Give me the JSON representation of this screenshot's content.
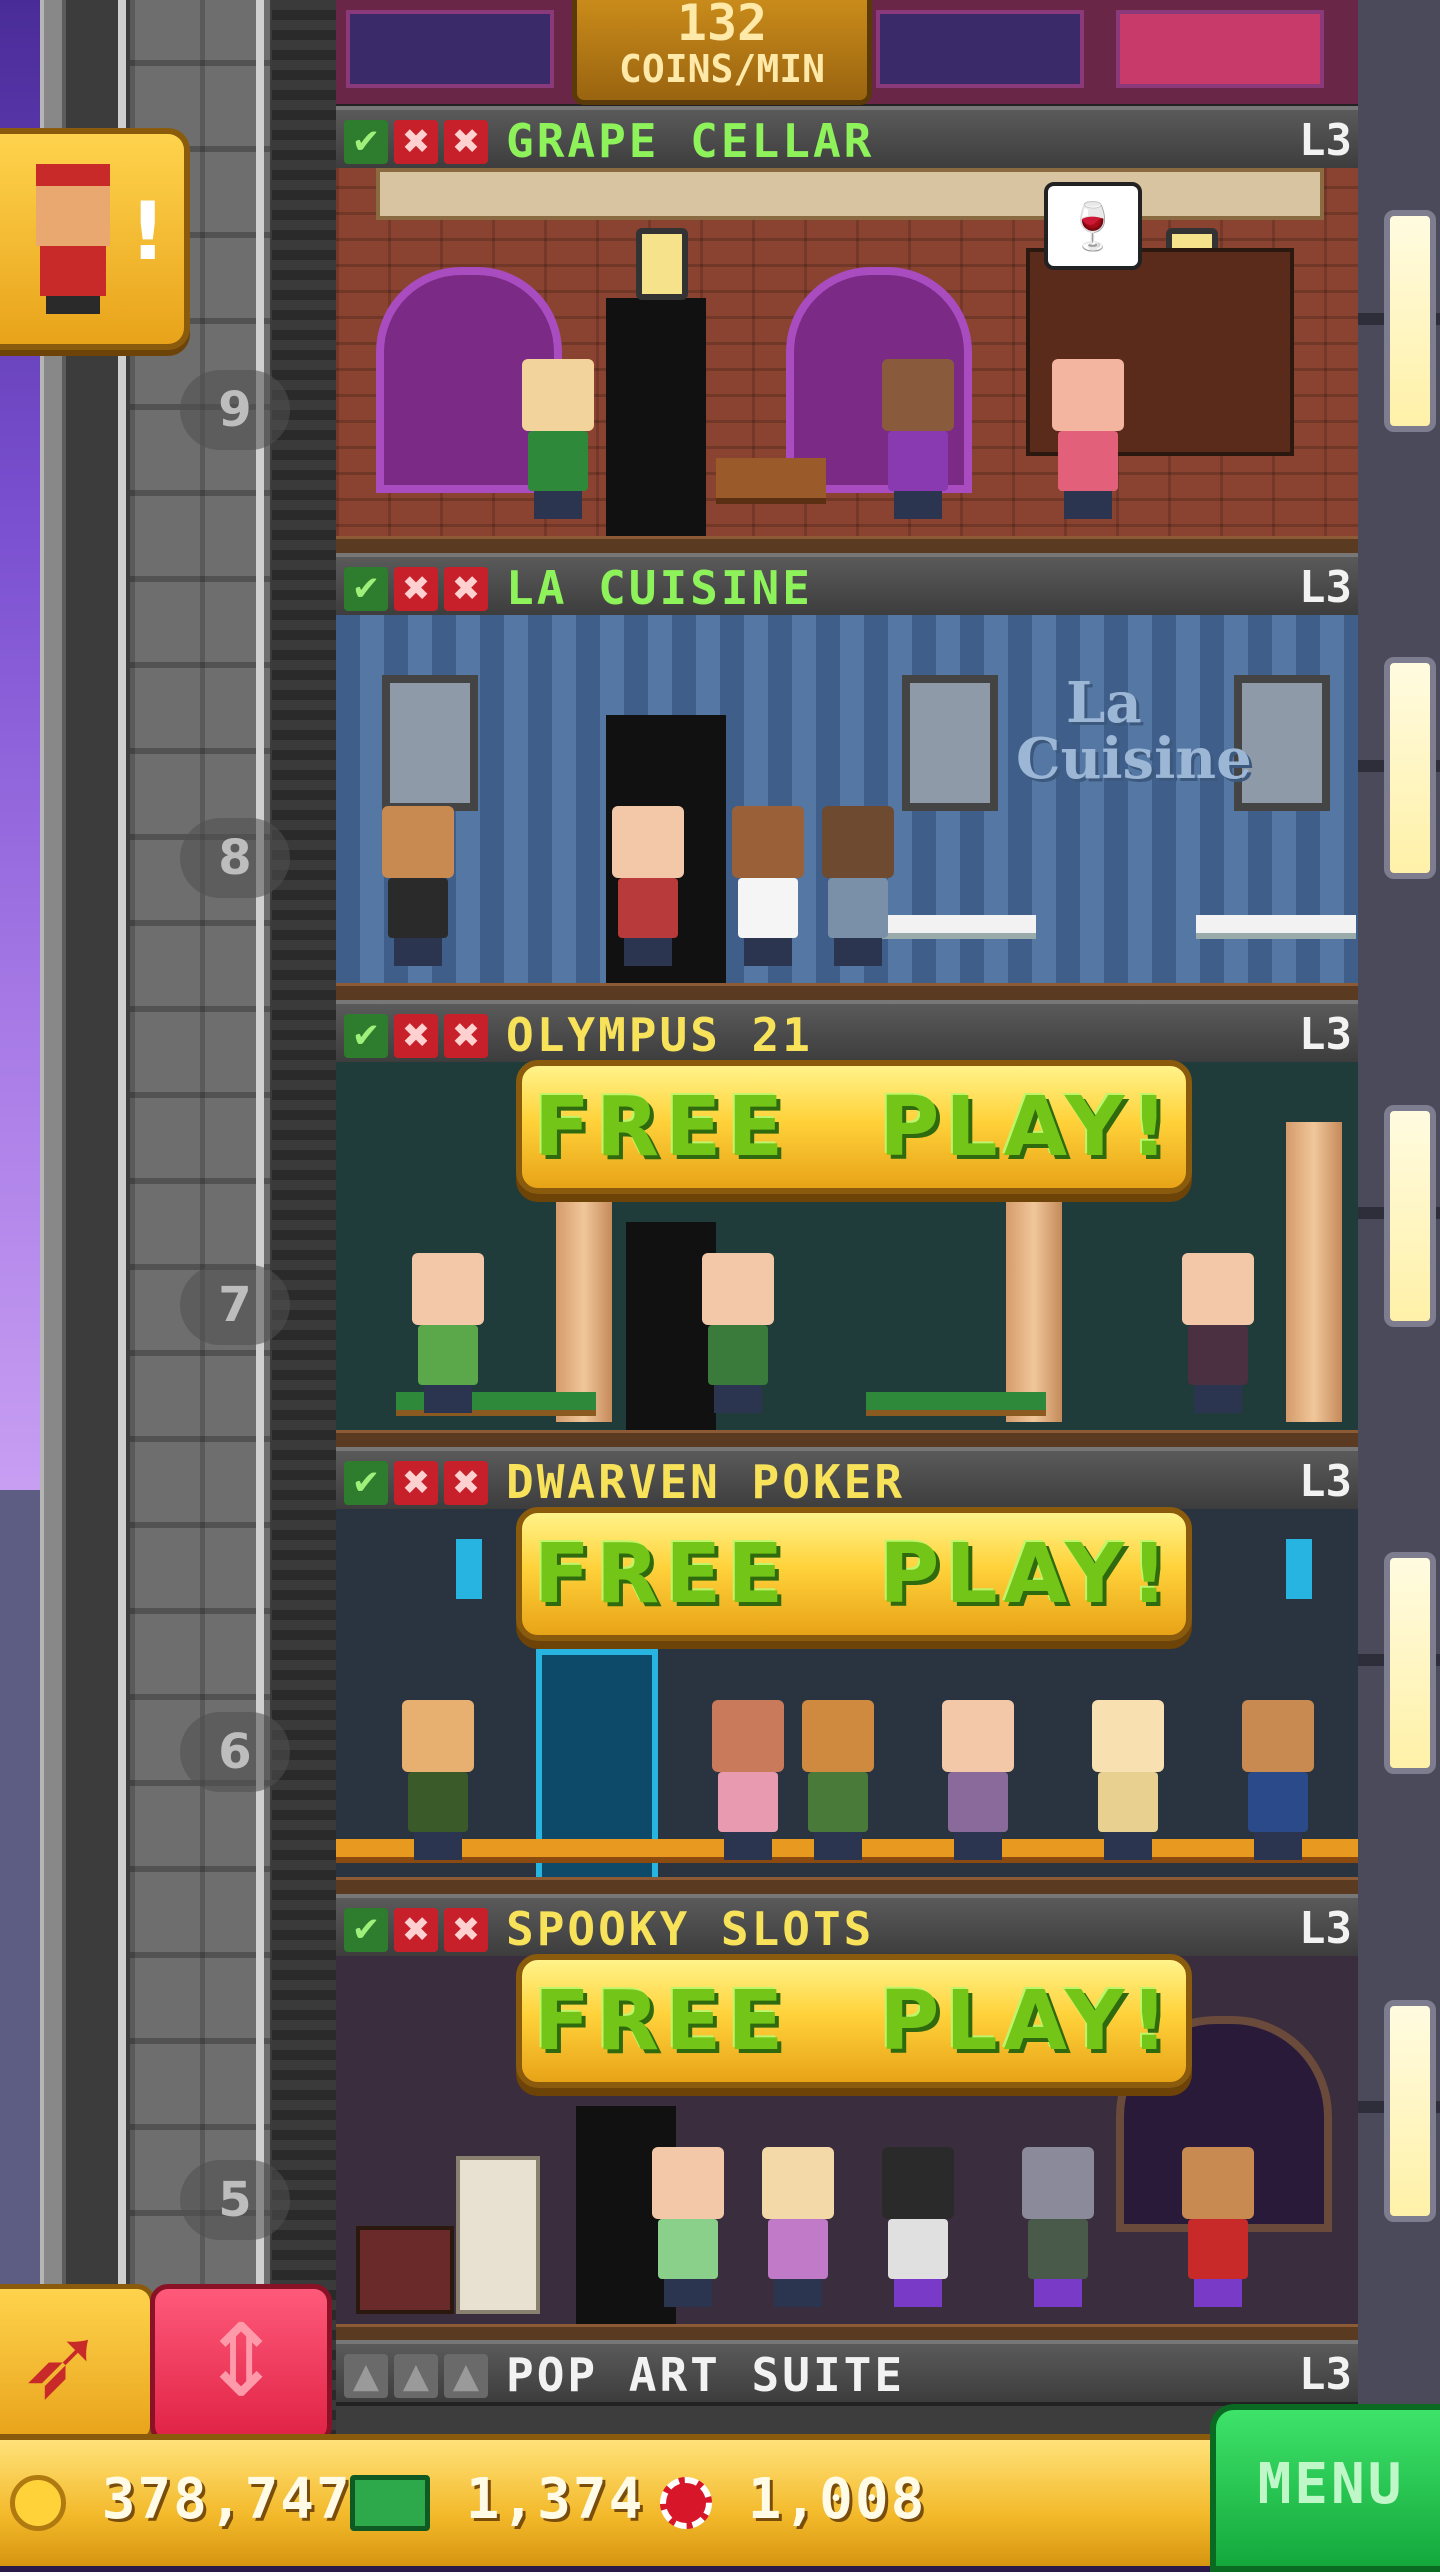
{
  "hud": {
    "coins_per_min_value": "132",
    "coins_per_min_unit": "COINS/MIN",
    "coins": "378,747",
    "bux": "1,374",
    "chips": "1,008",
    "menu_label": "MENU"
  },
  "floors": [
    {
      "number": "9",
      "name": "GRAPE CELLAR",
      "level": "L3",
      "name_color": "#8ef25a",
      "status": [
        "check",
        "x",
        "x"
      ]
    },
    {
      "number": "8",
      "name": "LA CUISINE",
      "level": "L3",
      "name_color": "#8ef25a",
      "status": [
        "check",
        "x",
        "x"
      ],
      "logo_line1": "La",
      "logo_line2": "Cuisine"
    },
    {
      "number": "7",
      "name": "OLYMPUS 21",
      "level": "L3",
      "name_color": "#f7e25a",
      "status": [
        "check",
        "x",
        "x"
      ],
      "free_play": [
        "FREE",
        "PLAY!"
      ]
    },
    {
      "number": "6",
      "name": "DWARVEN POKER",
      "level": "L3",
      "name_color": "#f7e25a",
      "status": [
        "check",
        "x",
        "x"
      ],
      "free_play": [
        "FREE",
        "PLAY!"
      ]
    },
    {
      "number": "5",
      "name": "SPOOKY SLOTS",
      "level": "L3",
      "name_color": "#f7e25a",
      "status": [
        "check",
        "x",
        "x"
      ],
      "free_play": [
        "FREE",
        "PLAY!"
      ]
    },
    {
      "number": "",
      "name": "POP ART SUITE",
      "level": "L3",
      "name_color": "#f2f2f2",
      "status": [
        "gray",
        "gray",
        "gray"
      ]
    }
  ],
  "icons": {
    "status_check": "✔",
    "status_x": "✖",
    "status_gray": "▲",
    "bellboy_alert": "!",
    "wine_bubble": "🍷",
    "elevator_arrows": "⇕",
    "rocket": "➶"
  },
  "colors": {
    "header_bg": "#3d3d3d",
    "free_play_text": "#73c618",
    "gold": "#ffd23a",
    "menu_green": "#14a83c"
  }
}
